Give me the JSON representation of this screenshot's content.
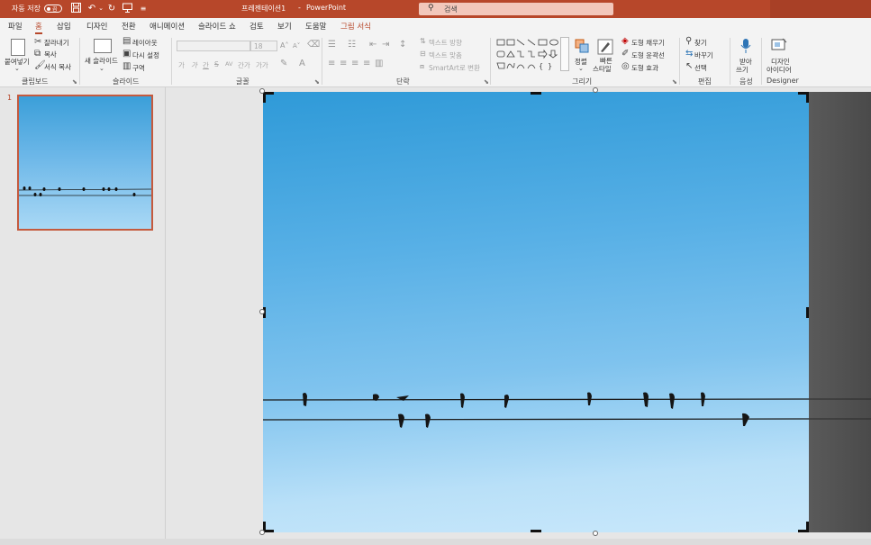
{
  "titlebar": {
    "autosave_label": "자동 저장",
    "autosave_state": "끔",
    "doc_title": "프레젠테이션1",
    "separator": "-",
    "app_name": "PowerPoint",
    "search_placeholder": "검색",
    "save_icon": "save-icon",
    "undo_icon": "undo-icon",
    "redo_icon": "redo-icon",
    "present_icon": "present-icon"
  },
  "tabs": [
    {
      "label": "파일"
    },
    {
      "label": "홈"
    },
    {
      "label": "삽입"
    },
    {
      "label": "디자인"
    },
    {
      "label": "전환"
    },
    {
      "label": "애니메이션"
    },
    {
      "label": "슬라이드 쇼"
    },
    {
      "label": "검토"
    },
    {
      "label": "보기"
    },
    {
      "label": "도움말"
    },
    {
      "label": "그림 서식"
    }
  ],
  "ribbon": {
    "clipboard": {
      "paste": "붙여넣기",
      "cut": "잘라내기",
      "copy": "복사",
      "format_painter": "서식 복사",
      "label": "클립보드"
    },
    "slides": {
      "new_slide": "새 슬라이드",
      "layout": "레이아웃",
      "reset": "다시 설정",
      "section": "구역",
      "label": "슬라이드"
    },
    "font": {
      "size": "18",
      "bold": "가",
      "italic": "가",
      "underline": "간",
      "strike": "S",
      "spacing": "AV",
      "case": "간가",
      "clear": "가가",
      "label": "글꼴"
    },
    "paragraph": {
      "text_direction": "텍스트 방향",
      "align_text": "텍스트 맞춤",
      "smartart": "SmartArt로 변환",
      "label": "단락"
    },
    "drawing": {
      "arrange": "정렬",
      "quick_styles_1": "빠른",
      "quick_styles_2": "스타일",
      "shape_fill": "도형 채우기",
      "shape_outline": "도형 윤곽선",
      "shape_effects": "도형 효과",
      "label": "그리기"
    },
    "editing": {
      "find": "찾기",
      "replace": "바꾸기",
      "select": "선택",
      "label": "편집"
    },
    "voice": {
      "dictate_1": "받아",
      "dictate_2": "쓰기",
      "label": "음성"
    },
    "designer": {
      "ideas_1": "디자인",
      "ideas_2": "아이디어",
      "label": "Designer"
    }
  },
  "slides_panel": {
    "current_number": "1"
  }
}
